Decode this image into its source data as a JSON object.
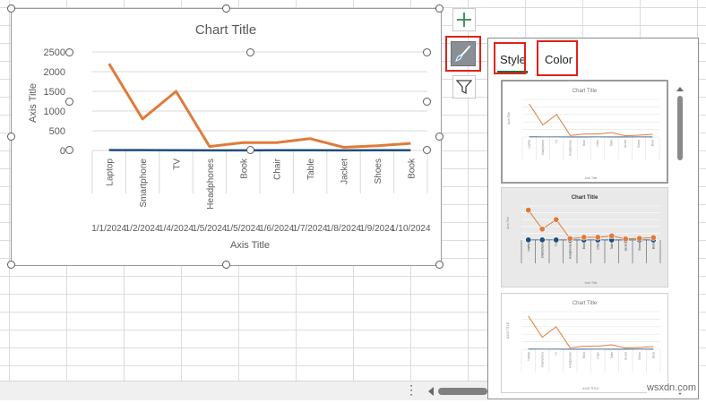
{
  "chart": {
    "title": "Chart Title",
    "y_axis_title": "Axis Title",
    "x_axis_title": "Axis Title"
  },
  "chart_data": {
    "type": "line",
    "categories": [
      "Laptop",
      "Smartphone",
      "TV",
      "Headphones",
      "Book",
      "Chair",
      "Table",
      "Jacket",
      "Shoes",
      "Book"
    ],
    "dates": [
      "1/1/2024",
      "1/2/2024",
      "1/4/2024",
      "1/5/2024",
      "1/5/2024",
      "1/6/2024",
      "1/7/2024",
      "1/8/2024",
      "1/9/2024",
      "1/10/2024"
    ],
    "series": [
      {
        "values": [
          10,
          8,
          6,
          3,
          4,
          7,
          5,
          4,
          6,
          5
        ],
        "color": "#1f4e79"
      },
      {
        "values": [
          2200,
          800,
          1500,
          100,
          200,
          200,
          300,
          80,
          120,
          180
        ],
        "color": "#e07b39"
      }
    ],
    "yticks": [
      0,
      500,
      1000,
      1500,
      2000,
      2500
    ],
    "ylim": [
      0,
      2500
    ],
    "grid": true,
    "legend": "none"
  },
  "side_buttons": {
    "elements": "chart-elements-plus-icon",
    "style": "paintbrush-icon",
    "filter": "funnel-icon"
  },
  "panel": {
    "tabs": [
      "Style",
      "Color"
    ],
    "selected_tab": "Style",
    "thumbnails": [
      {
        "title": "Chart Title",
        "y_axis": "Axis Title",
        "x_axis": "Axis Title"
      },
      {
        "title": "Chart Title",
        "y_axis": "Axis Title",
        "x_axis": "Axis Title"
      },
      {
        "title": "Chart Title",
        "y_axis": "AXIS TITLE",
        "x_axis": "AXIS TITLE"
      }
    ]
  },
  "status": {
    "more_icon": "⋮",
    "watermark": "wsxdn.com"
  },
  "colors": {
    "accent_green": "#217346",
    "highlight_red": "#e0221c",
    "series_orange": "#e07b39",
    "series_blue": "#1f4e79"
  }
}
